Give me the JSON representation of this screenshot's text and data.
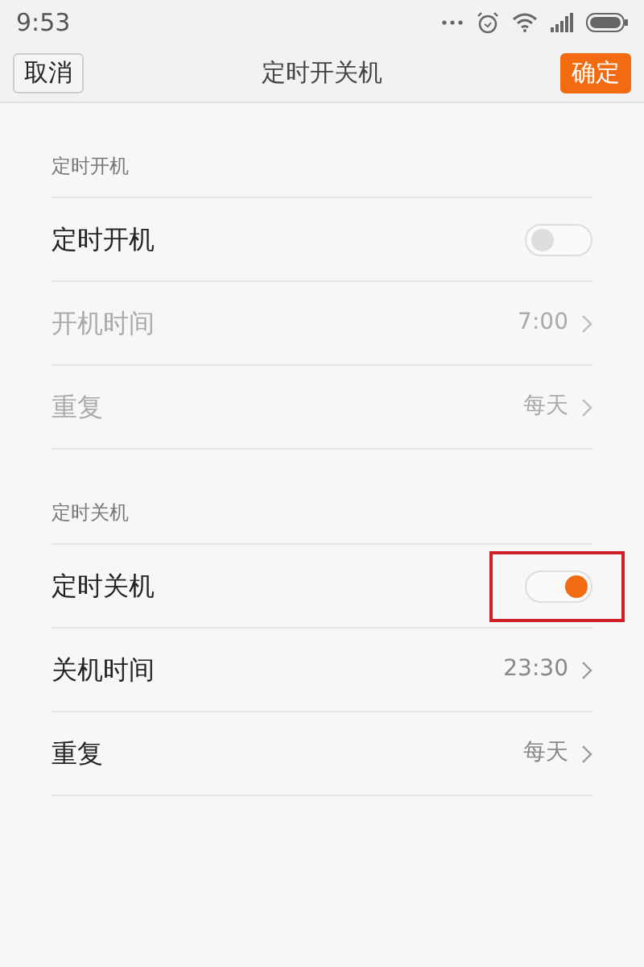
{
  "status_bar": {
    "time": "9:53"
  },
  "header": {
    "cancel": "取消",
    "title": "定时开关机",
    "confirm": "确定"
  },
  "sections": [
    {
      "title": "定时开机",
      "rows": [
        {
          "kind": "toggle",
          "label": "定时开机",
          "on": false,
          "disabled": false,
          "highlighted": false
        },
        {
          "kind": "value",
          "label": "开机时间",
          "value": "7:00",
          "disabled": true
        },
        {
          "kind": "value",
          "label": "重复",
          "value": "每天",
          "disabled": true
        }
      ]
    },
    {
      "title": "定时关机",
      "rows": [
        {
          "kind": "toggle",
          "label": "定时关机",
          "on": true,
          "disabled": false,
          "highlighted": true
        },
        {
          "kind": "value",
          "label": "关机时间",
          "value": "23:30",
          "disabled": false
        },
        {
          "kind": "value",
          "label": "重复",
          "value": "每天",
          "disabled": false
        }
      ]
    }
  ]
}
